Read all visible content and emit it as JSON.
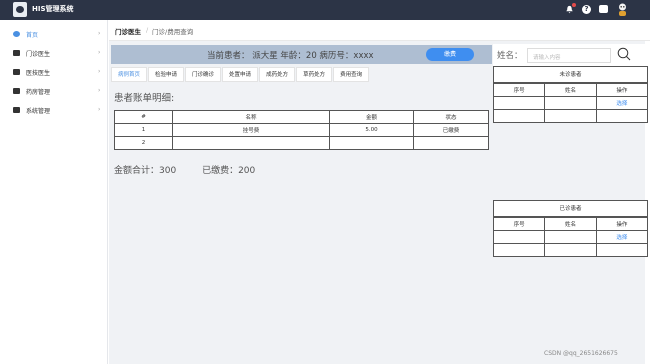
{
  "header": {
    "app_title": "HIS管理系统"
  },
  "sidebar": {
    "items": [
      {
        "label": "首页",
        "arrow": "›"
      },
      {
        "label": "门诊医生",
        "arrow": "›"
      },
      {
        "label": "医技医生",
        "arrow": "›"
      },
      {
        "label": "药房管理",
        "arrow": "›"
      },
      {
        "label": "系统管理",
        "arrow": "›"
      }
    ]
  },
  "breadcrumb": {
    "home": "门诊医生",
    "sep": "/",
    "path": "门诊/费用查询"
  },
  "patient_banner": {
    "text": "当前患者：  派大星   年龄：20   病历号：xxxx",
    "pay_button": "缴费"
  },
  "tabs": [
    "病例首页",
    "检验申请",
    "门诊确诊",
    "处置申请",
    "成药处方",
    "草药处方",
    "费用查询"
  ],
  "account": {
    "title": "患者账单明细:",
    "columns": [
      "#",
      "名称",
      "金额",
      "状态"
    ],
    "rows": [
      [
        "1",
        "挂号费",
        "5.00",
        "已缴费"
      ],
      [
        "2",
        "",
        "",
        ""
      ]
    ]
  },
  "totals": {
    "total": "金额合计：300",
    "paid": "已缴费：200"
  },
  "search": {
    "label": "姓名：",
    "placeholder": "请输入内容"
  },
  "pending_panel": {
    "title": "未诊患者",
    "columns": [
      "序号",
      "姓名",
      "操作"
    ],
    "rows": [
      [
        "",
        "",
        "选择"
      ],
      [
        "",
        "",
        ""
      ]
    ]
  },
  "done_panel": {
    "title": "已诊患者",
    "columns": [
      "序号",
      "姓名",
      "操作"
    ],
    "rows": [
      [
        "",
        "",
        "选择"
      ],
      [
        "",
        "",
        ""
      ]
    ]
  },
  "watermark": "CSDN @qq_2651626675",
  "colors": {
    "header_bg": "#2c3446",
    "accent": "#3f8ef0",
    "banner_bg": "#aebed2"
  }
}
